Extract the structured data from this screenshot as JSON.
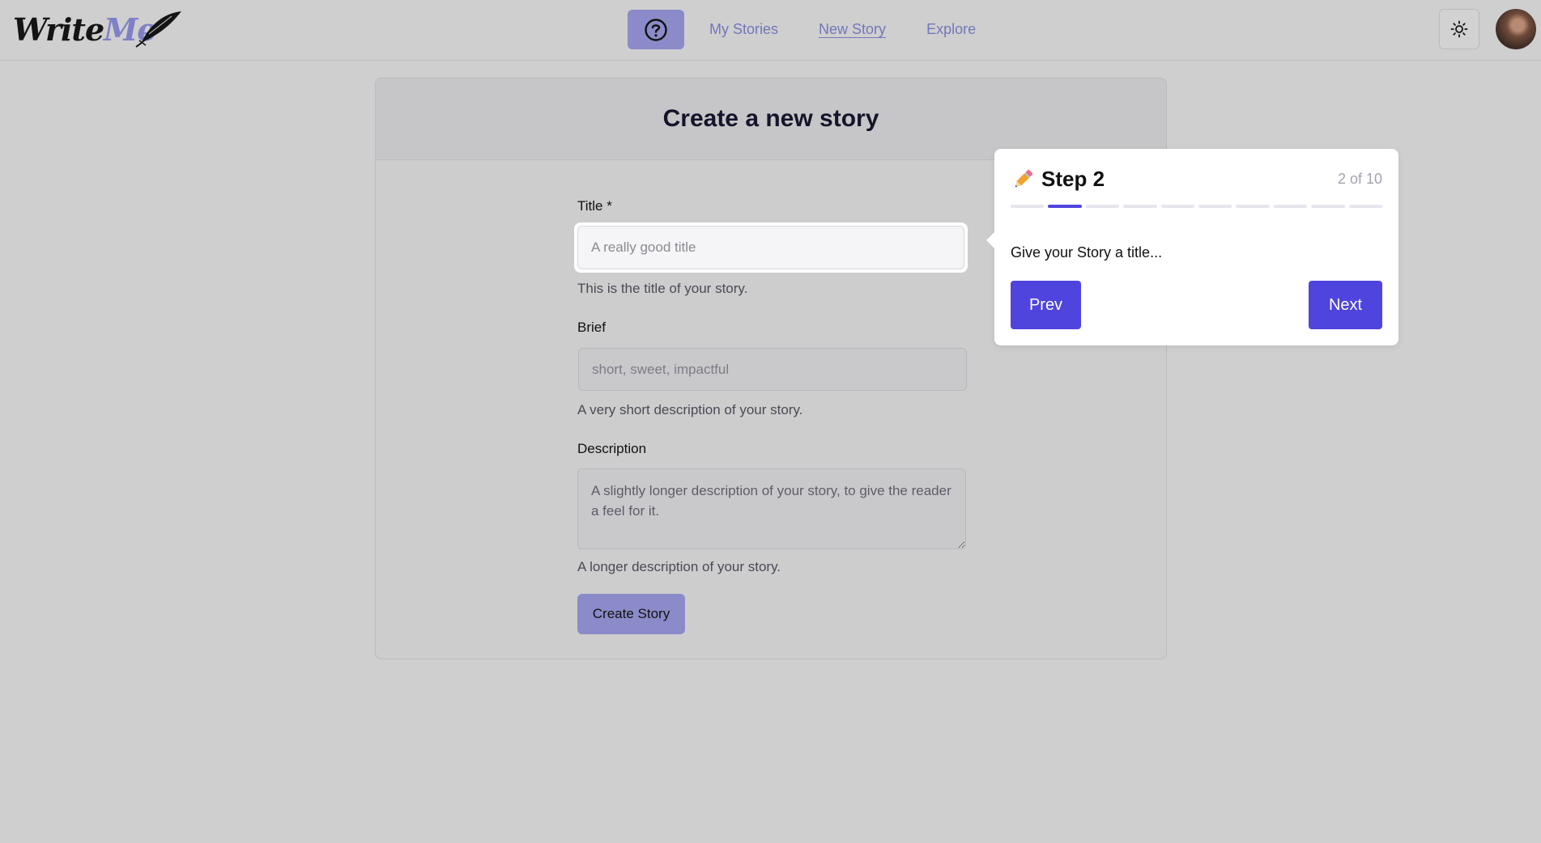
{
  "header": {
    "logo": {
      "part1": "Write",
      "part2": "Me"
    },
    "nav": {
      "help_icon": "question-circle-icon",
      "links": [
        "My Stories",
        "New Story",
        "Explore"
      ],
      "active": "New Story"
    },
    "theme_icon": "sun-icon"
  },
  "form": {
    "heading": "Create a new story",
    "title": {
      "label": "Title *",
      "placeholder": "A really good title",
      "helper": "This is the title of your story."
    },
    "brief": {
      "label": "Brief",
      "placeholder": "short, sweet, impactful",
      "helper": "A very short description of your story."
    },
    "description": {
      "label": "Description",
      "placeholder": "A slightly longer description of your story, to give the reader a feel for it.",
      "helper": "A longer description of your story."
    },
    "submit_label": "Create Story"
  },
  "tour": {
    "icon": "pencil-icon",
    "title": "Step 2",
    "counter": "2 of 10",
    "current_step": 2,
    "total_steps": 10,
    "body": "Give your Story a title...",
    "prev_label": "Prev",
    "next_label": "Next",
    "accent": "#4f44dd"
  }
}
